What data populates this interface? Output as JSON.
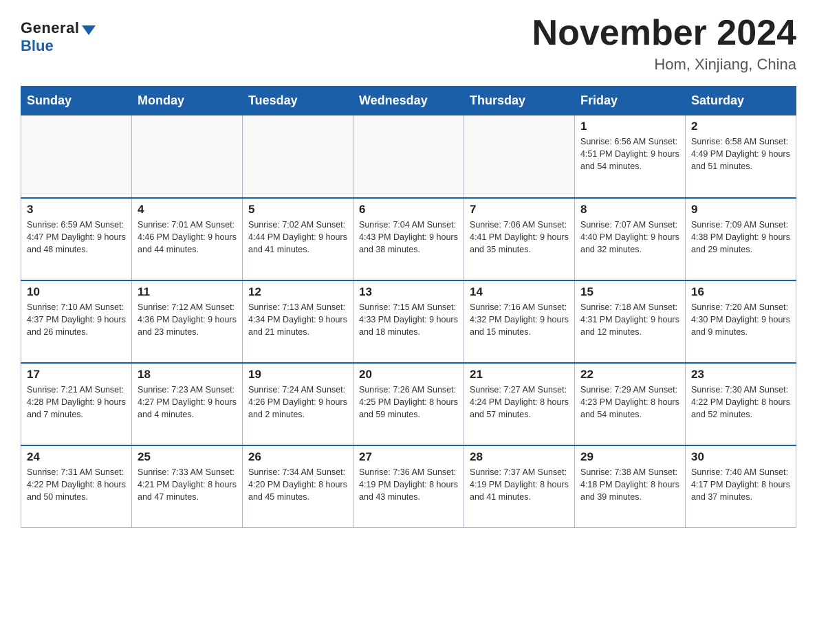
{
  "header": {
    "logo_general": "General",
    "logo_blue": "Blue",
    "month_title": "November 2024",
    "location": "Hom, Xinjiang, China"
  },
  "weekdays": [
    "Sunday",
    "Monday",
    "Tuesday",
    "Wednesday",
    "Thursday",
    "Friday",
    "Saturday"
  ],
  "weeks": [
    [
      {
        "day": "",
        "info": ""
      },
      {
        "day": "",
        "info": ""
      },
      {
        "day": "",
        "info": ""
      },
      {
        "day": "",
        "info": ""
      },
      {
        "day": "",
        "info": ""
      },
      {
        "day": "1",
        "info": "Sunrise: 6:56 AM\nSunset: 4:51 PM\nDaylight: 9 hours\nand 54 minutes."
      },
      {
        "day": "2",
        "info": "Sunrise: 6:58 AM\nSunset: 4:49 PM\nDaylight: 9 hours\nand 51 minutes."
      }
    ],
    [
      {
        "day": "3",
        "info": "Sunrise: 6:59 AM\nSunset: 4:47 PM\nDaylight: 9 hours\nand 48 minutes."
      },
      {
        "day": "4",
        "info": "Sunrise: 7:01 AM\nSunset: 4:46 PM\nDaylight: 9 hours\nand 44 minutes."
      },
      {
        "day": "5",
        "info": "Sunrise: 7:02 AM\nSunset: 4:44 PM\nDaylight: 9 hours\nand 41 minutes."
      },
      {
        "day": "6",
        "info": "Sunrise: 7:04 AM\nSunset: 4:43 PM\nDaylight: 9 hours\nand 38 minutes."
      },
      {
        "day": "7",
        "info": "Sunrise: 7:06 AM\nSunset: 4:41 PM\nDaylight: 9 hours\nand 35 minutes."
      },
      {
        "day": "8",
        "info": "Sunrise: 7:07 AM\nSunset: 4:40 PM\nDaylight: 9 hours\nand 32 minutes."
      },
      {
        "day": "9",
        "info": "Sunrise: 7:09 AM\nSunset: 4:38 PM\nDaylight: 9 hours\nand 29 minutes."
      }
    ],
    [
      {
        "day": "10",
        "info": "Sunrise: 7:10 AM\nSunset: 4:37 PM\nDaylight: 9 hours\nand 26 minutes."
      },
      {
        "day": "11",
        "info": "Sunrise: 7:12 AM\nSunset: 4:36 PM\nDaylight: 9 hours\nand 23 minutes."
      },
      {
        "day": "12",
        "info": "Sunrise: 7:13 AM\nSunset: 4:34 PM\nDaylight: 9 hours\nand 21 minutes."
      },
      {
        "day": "13",
        "info": "Sunrise: 7:15 AM\nSunset: 4:33 PM\nDaylight: 9 hours\nand 18 minutes."
      },
      {
        "day": "14",
        "info": "Sunrise: 7:16 AM\nSunset: 4:32 PM\nDaylight: 9 hours\nand 15 minutes."
      },
      {
        "day": "15",
        "info": "Sunrise: 7:18 AM\nSunset: 4:31 PM\nDaylight: 9 hours\nand 12 minutes."
      },
      {
        "day": "16",
        "info": "Sunrise: 7:20 AM\nSunset: 4:30 PM\nDaylight: 9 hours\nand 9 minutes."
      }
    ],
    [
      {
        "day": "17",
        "info": "Sunrise: 7:21 AM\nSunset: 4:28 PM\nDaylight: 9 hours\nand 7 minutes."
      },
      {
        "day": "18",
        "info": "Sunrise: 7:23 AM\nSunset: 4:27 PM\nDaylight: 9 hours\nand 4 minutes."
      },
      {
        "day": "19",
        "info": "Sunrise: 7:24 AM\nSunset: 4:26 PM\nDaylight: 9 hours\nand 2 minutes."
      },
      {
        "day": "20",
        "info": "Sunrise: 7:26 AM\nSunset: 4:25 PM\nDaylight: 8 hours\nand 59 minutes."
      },
      {
        "day": "21",
        "info": "Sunrise: 7:27 AM\nSunset: 4:24 PM\nDaylight: 8 hours\nand 57 minutes."
      },
      {
        "day": "22",
        "info": "Sunrise: 7:29 AM\nSunset: 4:23 PM\nDaylight: 8 hours\nand 54 minutes."
      },
      {
        "day": "23",
        "info": "Sunrise: 7:30 AM\nSunset: 4:22 PM\nDaylight: 8 hours\nand 52 minutes."
      }
    ],
    [
      {
        "day": "24",
        "info": "Sunrise: 7:31 AM\nSunset: 4:22 PM\nDaylight: 8 hours\nand 50 minutes."
      },
      {
        "day": "25",
        "info": "Sunrise: 7:33 AM\nSunset: 4:21 PM\nDaylight: 8 hours\nand 47 minutes."
      },
      {
        "day": "26",
        "info": "Sunrise: 7:34 AM\nSunset: 4:20 PM\nDaylight: 8 hours\nand 45 minutes."
      },
      {
        "day": "27",
        "info": "Sunrise: 7:36 AM\nSunset: 4:19 PM\nDaylight: 8 hours\nand 43 minutes."
      },
      {
        "day": "28",
        "info": "Sunrise: 7:37 AM\nSunset: 4:19 PM\nDaylight: 8 hours\nand 41 minutes."
      },
      {
        "day": "29",
        "info": "Sunrise: 7:38 AM\nSunset: 4:18 PM\nDaylight: 8 hours\nand 39 minutes."
      },
      {
        "day": "30",
        "info": "Sunrise: 7:40 AM\nSunset: 4:17 PM\nDaylight: 8 hours\nand 37 minutes."
      }
    ]
  ]
}
